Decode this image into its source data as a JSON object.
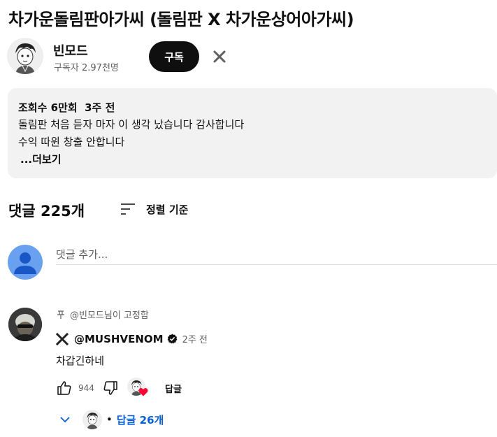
{
  "video": {
    "title": "차가운돌림판아가씨 (돌림판 X 차가운상어아가씨)"
  },
  "channel": {
    "name": "빈모드",
    "subscribers": "구독자 2.97천명",
    "subscribe_label": "구독",
    "avatar_icon": "channel-avatar-illustration",
    "dismiss_icon": "x-icon"
  },
  "description": {
    "meta": "조회수 6만회  3주 전",
    "lines": [
      "돌림판 처음 듣자 마자 이 생각 났습니다 감사합니다",
      "수익 따윈 창출 안합니다"
    ],
    "more_label": "...더보기"
  },
  "comments": {
    "count_label": "댓글 225개",
    "sort_label": "정렬 기준",
    "add_placeholder": "댓글 추가...",
    "items": [
      {
        "pinned_label": "@빈모드님이 고정함",
        "author": "@MUSHVENOM",
        "verified": true,
        "time": "2주 전",
        "text": "차갑긴하네",
        "likes": "944",
        "reply_label": "답글",
        "replies_label": "답글 26개",
        "creator_heart": true
      }
    ]
  },
  "colors": {
    "accent_blue": "#065fd4",
    "heart_red": "#ff0033",
    "subscribe_bg": "#0f0f0f",
    "description_bg": "#f2f2f2",
    "user_avatar_bg": "#6aa0f0"
  }
}
